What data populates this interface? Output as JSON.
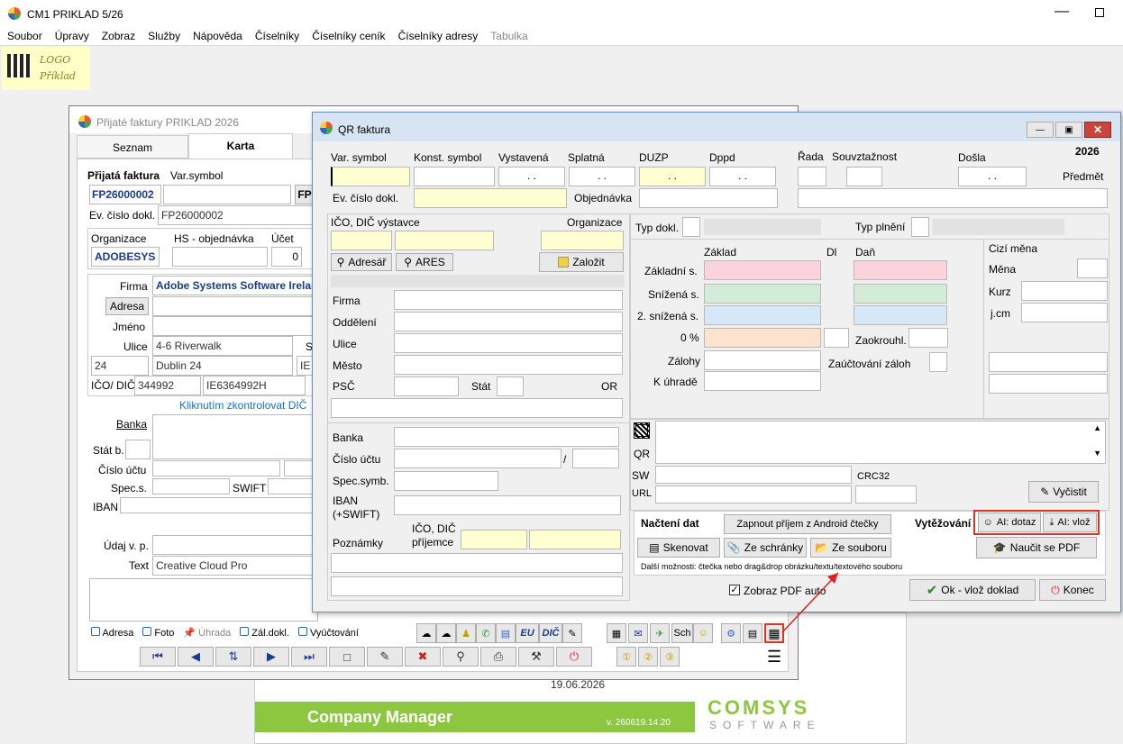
{
  "app": {
    "title": "CM1 PRIKLAD 5/26",
    "menu": [
      "Soubor",
      "Úpravy",
      "Zobraz",
      "Služby",
      "Nápověda",
      "Číselníky",
      "Číselníky ceník",
      "Číselníky adresy",
      "Tabulka"
    ],
    "logo_line1": "LOGO",
    "logo_line2": "Příklad"
  },
  "bg": {
    "date": "19.06.2026",
    "product": "Company Manager",
    "version": "v. 260619.14.20",
    "brand": "COMSYS",
    "brand_sub": "SOFTWARE"
  },
  "pf": {
    "title": "Přijaté faktury PRIKLAD 2026",
    "tabs": [
      "Seznam",
      "Karta"
    ],
    "label_invoice": "Přijatá faktura",
    "label_varsym": "Var.symbol",
    "invoice_no": "FP26000002",
    "btn_fp": "FP",
    "label_ev": "Ev. číslo dokl.",
    "ev_value": "FP26000002",
    "label_org": "Organizace",
    "label_hs": "HS - objednávka",
    "label_ucet": "Účet",
    "org_value": "ADOBESYS",
    "ucet_value": "0",
    "label_firma": "Firma",
    "firma_value": "Adobe Systems Software Irelan",
    "btn_adresa": "Adresa",
    "label_jmeno": "Jméno",
    "label_ulice": "Ulice",
    "ulice_value": "4-6 Riverwalk",
    "label_s": "S",
    "psc_value": "24",
    "city_value": "Dublin 24",
    "country_value": "IE",
    "label_ico": "IČO/ DIČ",
    "ico_value": "344992",
    "dic_value": "IE6364992H",
    "check_dic": "Kliknutím zkontrolovat DIČ",
    "label_banka": "Banka",
    "label_statb": "Stát b.",
    "label_cislo": "Číslo účtu",
    "label_specs": "Spec.s.",
    "label_swift": "SWIFT",
    "label_iban": "IBAN",
    "label_udaj": "Údaj v. p.",
    "label_text": "Text",
    "text_value": "Creative Cloud Pro",
    "links": [
      "Adresa",
      "Foto",
      "Úhrada",
      "Zál.dokl.",
      "Vyúčtování"
    ],
    "eu": "EU",
    "dic": "DIČ",
    "sch": "Sch"
  },
  "qr": {
    "title": "QR faktura",
    "year": "2026",
    "label_varsym": "Var. symbol",
    "label_konst": "Konst. symbol",
    "label_vyst": "Vystavená",
    "label_spl": "Splatná",
    "label_duzp": "DUZP",
    "label_dppd": "Dppd",
    "label_rada": "Řada",
    "label_souv": "Souvztažnost",
    "label_dosla": "Došla",
    "label_predmet": "Předmět",
    "date_placeholder": ". .",
    "label_ev": "Ev. číslo dokl.",
    "label_obj": "Objednávka",
    "label_ico_vyst": "IČO, DIČ výstavce",
    "label_org": "Organizace",
    "btn_adresar": "Adresář",
    "btn_ares": "ARES",
    "btn_zalozit": "Založit",
    "label_firma": "Firma",
    "label_oddeleni": "Oddělení",
    "label_ulice": "Ulice",
    "label_mesto": "Město",
    "label_psc": "PSČ",
    "label_stat": "Stát",
    "label_or": "OR",
    "label_banka": "Banka",
    "label_cislo": "Číslo účtu",
    "slash": "/",
    "label_spec": "Spec.symb.",
    "label_iban1": "IBAN",
    "label_iban2": "(+SWIFT)",
    "label_pozn": "Poznámky",
    "label_ico_prij1": "IČO, DIČ",
    "label_ico_prij2": "příjemce",
    "label_typ_dokl": "Typ dokl.",
    "label_typ_plneni": "Typ plnění",
    "label_zaklad": "Základ",
    "label_dl": "Dl",
    "label_dan": "Daň",
    "label_cizi": "Cizí měna",
    "label_mena": "Měna",
    "label_kurz": "Kurz",
    "label_jcm": "j.cm",
    "label_zakl_s": "Základní s.",
    "label_sniz": "Snížená s.",
    "label_2sniz": "2. snížená s.",
    "label_0": "0 %",
    "label_zalohy": "Zálohy",
    "label_kuhrade": "K úhradě",
    "label_zaokr": "Zaokrouhl.",
    "label_zauct": "Zaúčtování záloh",
    "label_qr": "QR",
    "label_sw": "SW",
    "label_url": "URL",
    "label_crc": "CRC32",
    "btn_vycistit": "Vyčistit",
    "label_nacteni": "Načtení dat",
    "btn_android": "Zapnout příjem z Android čtečky",
    "label_vytez": "Vytěžování",
    "btn_ai_dotaz": "AI: dotaz",
    "btn_ai_vloz": "AI: vlož",
    "btn_skenovat": "Skenovat",
    "btn_schranky": "Ze schránky",
    "btn_souboru": "Ze souboru",
    "btn_naucit": "Naučit se PDF",
    "hint": "Další možnosti: čtečka nebo drag&drop obrázku/textu/textového souboru",
    "chk_pdf": "Zobraz PDF auto",
    "btn_ok": "Ok - vlož doklad",
    "btn_konec": "Konec"
  }
}
